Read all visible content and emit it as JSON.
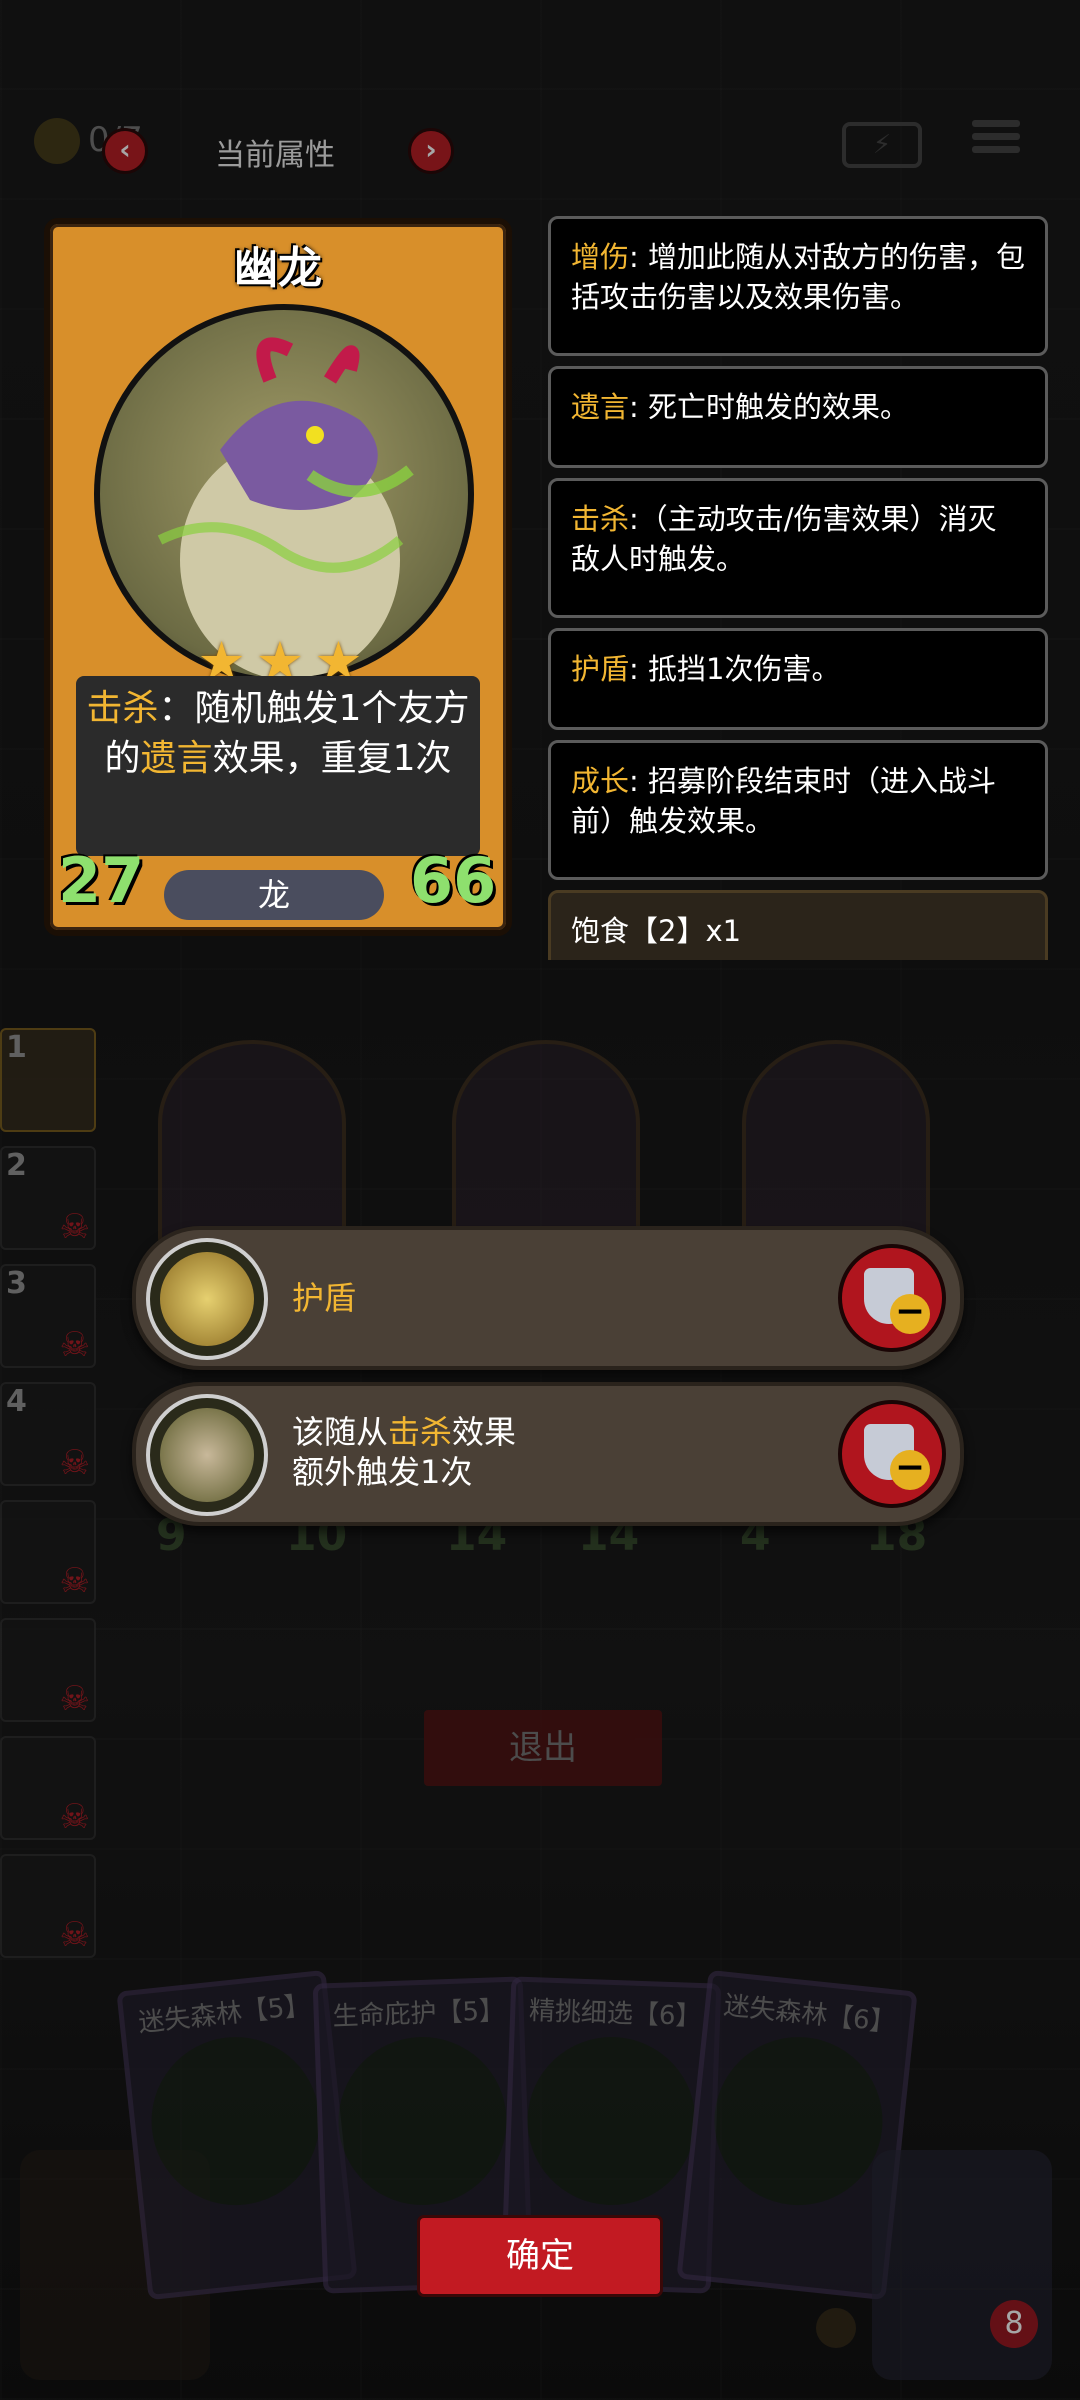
{
  "top": {
    "coin_value": "0/7",
    "title": "当前属性",
    "prev_label": "‹",
    "next_label": "›",
    "battery_label": "⚡"
  },
  "card": {
    "name": "幽龙",
    "stars": 3,
    "ability_prefix": "击杀",
    "ability_mid": "：随机触发1个友方的",
    "ability_kw2": "遗言",
    "ability_suffix": "效果，重复1次",
    "attack": "27",
    "health": "66",
    "tribe": "龙"
  },
  "keywords": [
    {
      "name": "增伤",
      "desc": ": 增加此随从对敌方的伤害，包括攻击伤害以及效果伤害。"
    },
    {
      "name": "遗言",
      "desc": ": 死亡时触发的效果。"
    },
    {
      "name": "击杀",
      "desc": ":（主动攻击/伤害效果）消灭敌人时触发。"
    },
    {
      "name": "护盾",
      "desc": ": 抵挡1次伤害。"
    },
    {
      "name": "成长",
      "desc": ": 招募阶段结束时（进入战斗前）触发效果。"
    },
    {
      "name": "",
      "desc": "饱食【2】x1"
    }
  ],
  "sidebar": {
    "slots": [
      "1",
      "2",
      "3",
      "4",
      "",
      "",
      "",
      ""
    ]
  },
  "board": {
    "stats": [
      "9",
      "10",
      "14",
      "14",
      "4",
      "18"
    ]
  },
  "buffs": [
    {
      "label": "护盾"
    },
    {
      "line1_prefix": "该随从",
      "line1_kw": "击杀",
      "line1_suffix": "效果",
      "line2": "额外触发1次"
    }
  ],
  "buttons": {
    "exit": "退出",
    "confirm": "确定"
  },
  "spells": [
    {
      "name": "迷失森林【5】"
    },
    {
      "name": "生命庇护【5】"
    },
    {
      "name": "精挑细选【6】"
    },
    {
      "name": "迷失森林【6】"
    }
  ],
  "player": {
    "lives": "8"
  },
  "colors": {
    "keyword": "#f2b632",
    "stat_green": "#8ee06e",
    "button_red": "#c21a22"
  }
}
